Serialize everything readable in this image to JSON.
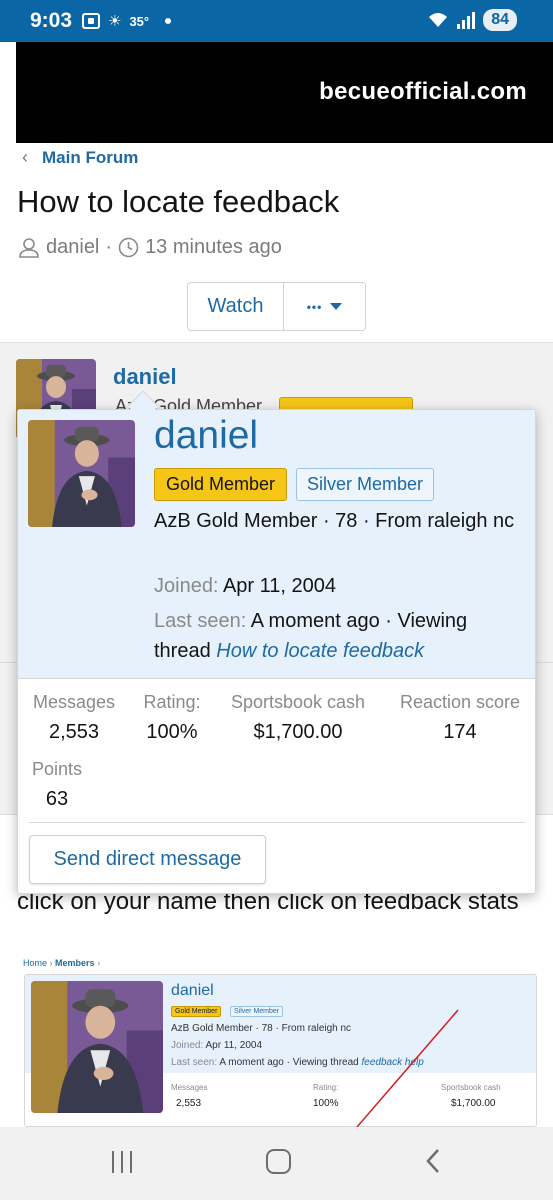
{
  "status_bar": {
    "time": "9:03",
    "temperature": "35°",
    "battery": "84"
  },
  "banner": {
    "text": "becueofficial.com"
  },
  "header": {
    "breadcrumb": "Main Forum",
    "title": "How to locate feedback",
    "author": "daniel",
    "separator": "·",
    "time_ago": "13 minutes ago",
    "watch_label": "Watch",
    "more_label": "•••"
  },
  "post": {
    "author_name": "daniel",
    "under_name": "AzB Gold Member",
    "body_text": "click on your name then click on feedback stats"
  },
  "member_card": {
    "name": "daniel",
    "badge_gold": "Gold Member",
    "badge_silver": "Silver Member",
    "title_line": "AzB Gold Member · 78 · From raleigh nc",
    "joined_label": "Joined:",
    "joined_value": "Apr 11, 2004",
    "last_seen_label": "Last seen:",
    "last_seen_value": "A moment ago · Viewing thread",
    "last_seen_link": "How to locate feedback",
    "stats": [
      {
        "label": "Messages",
        "value": "2,553"
      },
      {
        "label": "Rating:",
        "value": "100%"
      },
      {
        "label": "Sportsbook cash",
        "value": "$1,700.00"
      },
      {
        "label": "Reaction score",
        "value": "174"
      },
      {
        "label": "Points",
        "value": "63"
      }
    ],
    "send_message_label": "Send direct message"
  },
  "embedded_screenshot": {
    "crumb_home": "Home",
    "crumb_sep": "›",
    "crumb_members": "Members",
    "name": "daniel",
    "badge_gold": "Gold Member",
    "badge_silver": "Silver Member",
    "title_line": "AzB Gold Member · 78 · From raleigh nc",
    "joined_label": "Joined:",
    "joined_value": "Apr 11, 2004",
    "last_seen_label": "Last seen:",
    "last_seen_value": "A moment ago · Viewing thread",
    "last_seen_link": "feedback help",
    "stats": [
      {
        "label": "Messages",
        "value": "2,553"
      },
      {
        "label": "Rating:",
        "value": "100%"
      },
      {
        "label": "Sportsbook cash",
        "value": "$1,700.00"
      }
    ]
  },
  "colors": {
    "status_bar": "#0b66a6",
    "link": "#1f6aa3",
    "gold_badge": "#f5c518",
    "card_header": "#e6f1fb"
  }
}
